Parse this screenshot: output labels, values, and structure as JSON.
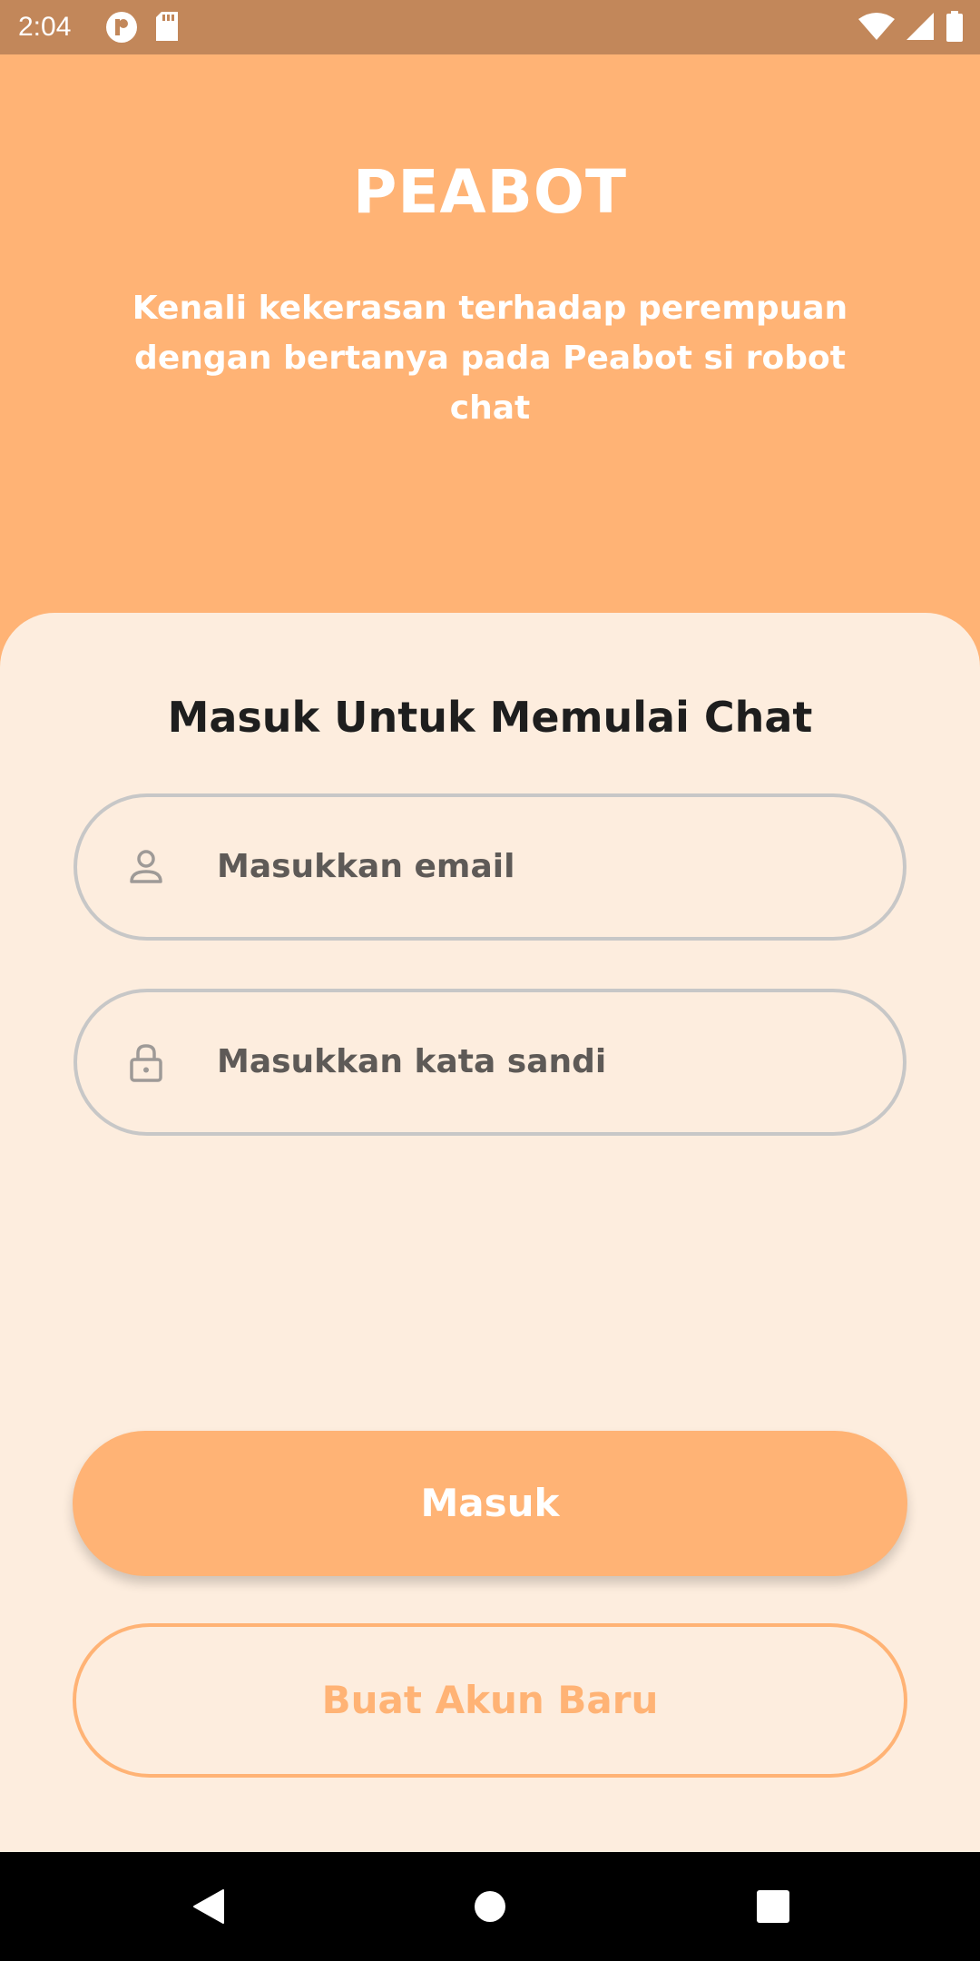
{
  "status_bar": {
    "time": "2:04",
    "icons": [
      "notification-p-icon",
      "sd-card-icon",
      "wifi-icon",
      "signal-icon",
      "battery-icon"
    ]
  },
  "header": {
    "title": "PEABOT",
    "subtitle_line1": "Kenali kekerasan terhadap perempuan",
    "subtitle_line2": "dengan bertanya pada Peabot si robot chat"
  },
  "login": {
    "heading": "Masuk Untuk Memulai Chat",
    "email_placeholder": "Masukkan email",
    "password_placeholder": "Masukkan kata sandi",
    "login_button": "Masuk",
    "register_button": "Buat Akun Baru"
  },
  "colors": {
    "accent": "#FFB375",
    "status_bar": "#C2875A",
    "card_bg": "#FDEDDE",
    "field_border": "#C7C7C7"
  }
}
